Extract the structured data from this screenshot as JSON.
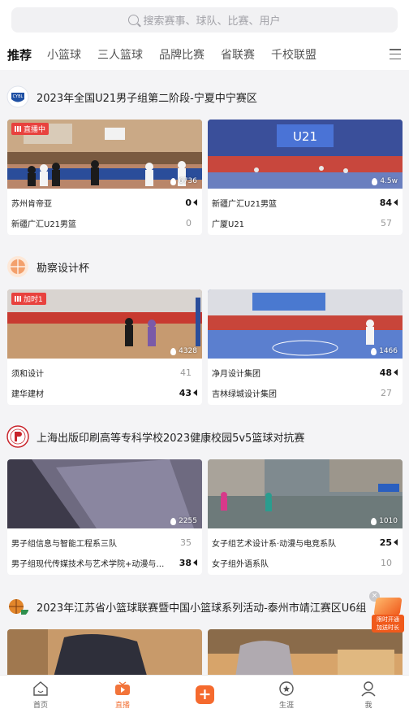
{
  "search": {
    "placeholder": "搜索赛事、球队、比赛、用户"
  },
  "tabs": [
    "推荐",
    "小篮球",
    "三人篮球",
    "品牌比赛",
    "省联赛",
    "千校联盟"
  ],
  "sections": [
    {
      "title": "2023年全国U21男子组第二阶段-宁夏中宁赛区",
      "games": [
        {
          "badge": "直播中",
          "views": "6736",
          "teams": [
            {
              "name": "苏州肯帝亚",
              "score": "0",
              "win": true
            },
            {
              "name": "新疆广汇U21男篮",
              "score": "0",
              "win": false
            }
          ]
        },
        {
          "badge": "",
          "views": "4.5w",
          "teams": [
            {
              "name": "新疆广汇U21男篮",
              "score": "84",
              "win": true
            },
            {
              "name": "广厦U21",
              "score": "57",
              "win": false
            }
          ]
        }
      ]
    },
    {
      "title": "勘察设计杯",
      "games": [
        {
          "badge": "加时1",
          "views": "4328",
          "teams": [
            {
              "name": "须和设计",
              "score": "41",
              "win": false
            },
            {
              "name": "建华建材",
              "score": "43",
              "win": true
            }
          ]
        },
        {
          "badge": "",
          "views": "1466",
          "teams": [
            {
              "name": "净月设计集团",
              "score": "48",
              "win": true
            },
            {
              "name": "吉林绿城设计集团",
              "score": "27",
              "win": false
            }
          ]
        }
      ]
    },
    {
      "title": "上海出版印刷高等专科学校2023健康校园5v5篮球对抗赛",
      "games": [
        {
          "badge": "",
          "views": "2255",
          "teams": [
            {
              "name": "男子组信息与智能工程系三队",
              "score": "35",
              "win": false
            },
            {
              "name": "男子组现代传媒技术与艺术学院+动漫与电…",
              "score": "38",
              "win": true
            }
          ]
        },
        {
          "badge": "",
          "views": "1010",
          "teams": [
            {
              "name": "女子组艺术设计系·动漫与电竞系队",
              "score": "25",
              "win": true
            },
            {
              "name": "女子组外语系队",
              "score": "10",
              "win": false
            }
          ]
        }
      ]
    },
    {
      "title": "2023年江苏省小篮球联赛暨中国小篮球系列活动-泰州市靖江赛区U6组",
      "games": []
    }
  ],
  "promo": {
    "line1": "限时开通",
    "line2": "加送时长"
  },
  "bottom_nav": [
    {
      "label": "首页",
      "icon": "home-icon"
    },
    {
      "label": "直播",
      "icon": "live-tv-icon"
    },
    {
      "label": "",
      "icon": "plus-icon"
    },
    {
      "label": "生涯",
      "icon": "career-icon"
    },
    {
      "label": "我",
      "icon": "profile-icon"
    }
  ],
  "colors": {
    "accent": "#f56a2e",
    "live": "#e8423e"
  }
}
